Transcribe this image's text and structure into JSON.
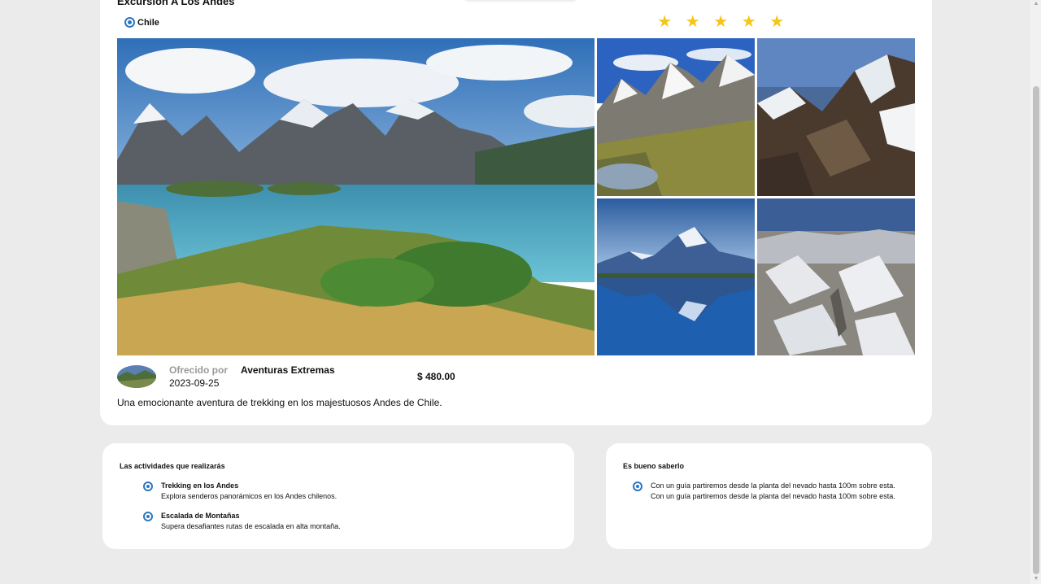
{
  "excursion": {
    "title": "Excursión A Los Andes",
    "country": "Chile",
    "rating": 5,
    "offered_label": "Ofrecido por",
    "date": "2023-09-25",
    "provider": "Aventuras Extremas",
    "price": "$ 480.00",
    "description": "Una emocionante aventura de trekking en los majestuosos Andes de Chile."
  },
  "icons": {
    "star": "star-icon",
    "radio": "radio-selected-icon"
  },
  "colors": {
    "accent": "#2d76c0",
    "star": "#f5c518",
    "background": "#ebebeb"
  },
  "activities": {
    "title": "Las actividades que realizarás",
    "items": [
      {
        "title": "Trekking en los Andes",
        "description": "Explora senderos panorámicos en los Andes chilenos."
      },
      {
        "title": "Escalada de Montañas",
        "description": "Supera desafiantes rutas de escalada en alta montaña."
      }
    ]
  },
  "info": {
    "title": "Es bueno saberlo",
    "items": [
      {
        "text": "Con un guía partiremos desde la planta del nevado hasta 100m sobre esta. Con un guía partiremos desde la planta del nevado hasta 100m sobre esta."
      }
    ]
  }
}
